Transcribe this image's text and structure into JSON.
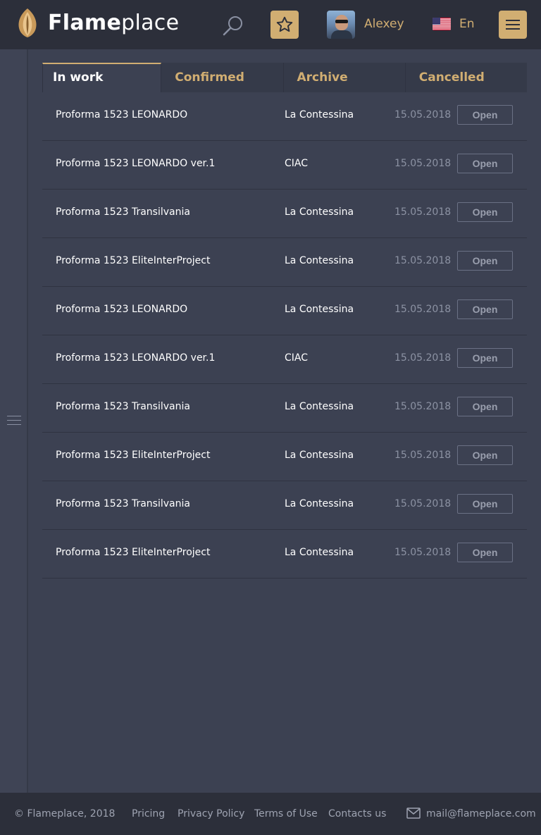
{
  "header": {
    "brand_bold": "Flame",
    "brand_light": "place",
    "username": "Alexey",
    "language": "En",
    "accent_color": "#d1ae72"
  },
  "tabs": [
    {
      "label": "In work",
      "active": true
    },
    {
      "label": "Confirmed",
      "active": false
    },
    {
      "label": "Archive",
      "active": false
    },
    {
      "label": "Cancelled",
      "active": false
    }
  ],
  "rows": [
    {
      "name": "Proforma 1523 LEONARDO",
      "company": "La Contessina",
      "date": "15.05.2018",
      "action": "Open"
    },
    {
      "name": "Proforma 1523 LEONARDO ver.1",
      "company": "CIAC",
      "date": "15.05.2018",
      "action": "Open"
    },
    {
      "name": "Proforma 1523 Transilvania",
      "company": "La Contessina",
      "date": "15.05.2018",
      "action": "Open"
    },
    {
      "name": "Proforma 1523 EliteInterProject",
      "company": "La Contessina",
      "date": "15.05.2018",
      "action": "Open"
    },
    {
      "name": "Proforma 1523 LEONARDO",
      "company": "La Contessina",
      "date": "15.05.2018",
      "action": "Open"
    },
    {
      "name": "Proforma 1523 LEONARDO ver.1",
      "company": "CIAC",
      "date": "15.05.2018",
      "action": "Open"
    },
    {
      "name": "Proforma 1523 Transilvania",
      "company": "La Contessina",
      "date": "15.05.2018",
      "action": "Open"
    },
    {
      "name": "Proforma 1523 EliteInterProject",
      "company": "La Contessina",
      "date": "15.05.2018",
      "action": "Open"
    },
    {
      "name": "Proforma 1523 Transilvania",
      "company": "La Contessina",
      "date": "15.05.2018",
      "action": "Open"
    },
    {
      "name": "Proforma 1523 EliteInterProject",
      "company": "La Contessina",
      "date": "15.05.2018",
      "action": "Open"
    }
  ],
  "footer": {
    "copyright": "© Flameplace, 2018",
    "links": [
      "Pricing",
      "Privacy Policy",
      "Terms of Use",
      "Contacts us"
    ],
    "email": "mail@flameplace.com"
  },
  "icons": {
    "logo": "flame-icon",
    "search": "search-icon",
    "favorites": "star-icon",
    "language_flag": "us-flag-icon",
    "menu": "hamburger-icon",
    "sidebar_toggle": "list-icon",
    "mail": "mail-icon"
  }
}
